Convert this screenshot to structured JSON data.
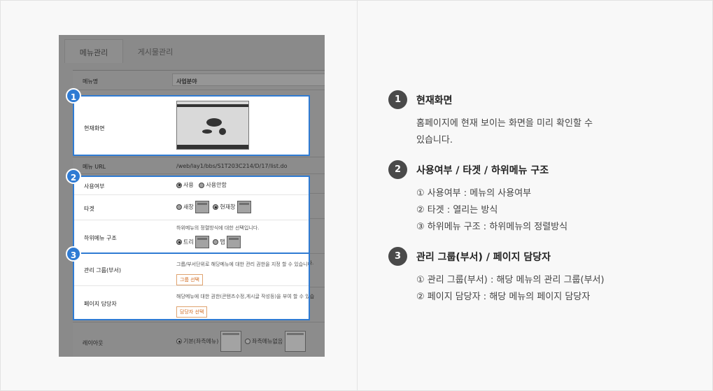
{
  "screenshot": {
    "tabs": [
      "메뉴관리",
      "게시물관리"
    ],
    "rows": {
      "menu_name": {
        "label": "메뉴명",
        "value": "사업분야"
      },
      "current_screen": {
        "label": "현재화면"
      },
      "menu_url": {
        "label": "메뉴 URL",
        "value": "/web/lay1/bbs/S1T203C214/D/17/list.do"
      },
      "use": {
        "label": "사용여부",
        "opt1": "사용",
        "opt2": "사용안함"
      },
      "target": {
        "label": "타겟",
        "opt1": "새창",
        "opt2": "현재창"
      },
      "submenu": {
        "label": "하위메뉴 구조",
        "hint": "하위메뉴의 정렬방식에 대한 선택입니다.",
        "opt1": "트리",
        "opt2": "탭"
      },
      "group": {
        "label": "관리 그룹(부서)",
        "hint": "그룹/부서단위로 해당메뉴에 대한 관리 권한을 지정 할 수 있습니다.",
        "button": "그룹 선택"
      },
      "manager": {
        "label": "페이지 담당자",
        "hint": "해당메뉴에 대한 권한(콘텐츠수정,게시글 작성등)을 부여 할 수 있습",
        "button": "담당자 선택"
      },
      "layout": {
        "label": "레이아웃",
        "opt1": "기본(좌측메뉴)",
        "opt2": "좌측메뉴없음"
      }
    },
    "badges": [
      "1",
      "2",
      "3"
    ]
  },
  "explanations": [
    {
      "num": "1",
      "title": "현재화면",
      "lines": [
        "홈페이지에 현재 보이는 화면을 미리 확인할 수",
        "있습니다."
      ]
    },
    {
      "num": "2",
      "title": "사용여부 / 타겟 / 하위메뉴 구조",
      "lines": [
        "① 사용여부 : 메뉴의 사용여부",
        "② 타겟 : 열리는 방식",
        "③ 하위메뉴 구조 : 하위메뉴의 정렬방식"
      ]
    },
    {
      "num": "3",
      "title": "관리 그룹(부서) / 페이지 담당자",
      "lines": [
        "① 관리 그룹(부서) : 해당 메뉴의 관리 그룹(부서)",
        "② 페이지 담당자 : 해당 메뉴의 페이지 담당자"
      ]
    }
  ],
  "colors": {
    "highlight": "#2f7bd3",
    "badge_dark": "#4a4a4a",
    "overlay": "#8a8a8a"
  }
}
